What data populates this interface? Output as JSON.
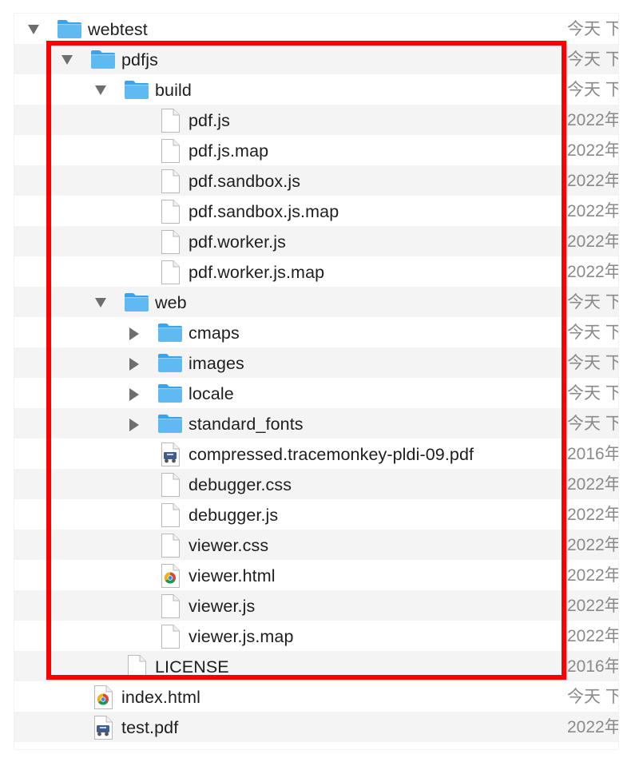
{
  "colors": {
    "highlight_border": "#ff0000",
    "folder_fill": "#5fbaf2",
    "folder_tab": "#3aa3ec",
    "row_alt": "#f4f4f5",
    "text": "#1e1e1e",
    "date_text": "#8a8a8a"
  },
  "items": [
    {
      "name": "webtest",
      "date": "今天 下",
      "kind": "folder",
      "depth": 0,
      "disclosure": "expanded",
      "icon": "folder-icon"
    },
    {
      "name": "pdfjs",
      "date": "今天 下",
      "kind": "folder",
      "depth": 1,
      "disclosure": "expanded",
      "icon": "folder-icon"
    },
    {
      "name": "build",
      "date": "今天 下",
      "kind": "folder",
      "depth": 2,
      "disclosure": "expanded",
      "icon": "folder-icon"
    },
    {
      "name": "pdf.js",
      "date": "2022年",
      "kind": "file",
      "depth": 3,
      "disclosure": "none",
      "icon": "document-icon"
    },
    {
      "name": "pdf.js.map",
      "date": "2022年",
      "kind": "file",
      "depth": 3,
      "disclosure": "none",
      "icon": "document-icon"
    },
    {
      "name": "pdf.sandbox.js",
      "date": "2022年",
      "kind": "file",
      "depth": 3,
      "disclosure": "none",
      "icon": "document-icon"
    },
    {
      "name": "pdf.sandbox.js.map",
      "date": "2022年",
      "kind": "file",
      "depth": 3,
      "disclosure": "none",
      "icon": "document-icon"
    },
    {
      "name": "pdf.worker.js",
      "date": "2022年",
      "kind": "file",
      "depth": 3,
      "disclosure": "none",
      "icon": "document-icon"
    },
    {
      "name": "pdf.worker.js.map",
      "date": "2022年",
      "kind": "file",
      "depth": 3,
      "disclosure": "none",
      "icon": "document-icon"
    },
    {
      "name": "web",
      "date": "今天 下",
      "kind": "folder",
      "depth": 2,
      "disclosure": "expanded",
      "icon": "folder-icon"
    },
    {
      "name": "cmaps",
      "date": "今天 下",
      "kind": "folder",
      "depth": 3,
      "disclosure": "collapsed",
      "icon": "folder-icon"
    },
    {
      "name": "images",
      "date": "今天 下",
      "kind": "folder",
      "depth": 3,
      "disclosure": "collapsed",
      "icon": "folder-icon"
    },
    {
      "name": "locale",
      "date": "今天 下",
      "kind": "folder",
      "depth": 3,
      "disclosure": "collapsed",
      "icon": "folder-icon"
    },
    {
      "name": "standard_fonts",
      "date": "今天 下",
      "kind": "folder",
      "depth": 3,
      "disclosure": "collapsed",
      "icon": "folder-icon"
    },
    {
      "name": "compressed.tracemonkey-pldi-09.pdf",
      "date": "2016年",
      "kind": "pdf",
      "depth": 3,
      "disclosure": "none",
      "icon": "pdf-preview-icon"
    },
    {
      "name": "debugger.css",
      "date": "2022年",
      "kind": "file",
      "depth": 3,
      "disclosure": "none",
      "icon": "document-icon"
    },
    {
      "name": "debugger.js",
      "date": "2022年",
      "kind": "file",
      "depth": 3,
      "disclosure": "none",
      "icon": "document-icon"
    },
    {
      "name": "viewer.css",
      "date": "2022年",
      "kind": "file",
      "depth": 3,
      "disclosure": "none",
      "icon": "document-icon"
    },
    {
      "name": "viewer.html",
      "date": "2022年",
      "kind": "html",
      "depth": 3,
      "disclosure": "none",
      "icon": "chrome-html-icon"
    },
    {
      "name": "viewer.js",
      "date": "2022年",
      "kind": "file",
      "depth": 3,
      "disclosure": "none",
      "icon": "document-icon"
    },
    {
      "name": "viewer.js.map",
      "date": "2022年",
      "kind": "file",
      "depth": 3,
      "disclosure": "none",
      "icon": "document-icon"
    },
    {
      "name": "LICENSE",
      "date": "2016年",
      "kind": "file",
      "depth": 2,
      "disclosure": "none",
      "icon": "document-icon"
    },
    {
      "name": "index.html",
      "date": "今天 下",
      "kind": "html",
      "depth": 1,
      "disclosure": "none",
      "icon": "chrome-html-icon"
    },
    {
      "name": "test.pdf",
      "date": "2022年",
      "kind": "pdf",
      "depth": 1,
      "disclosure": "none",
      "icon": "pdf-preview-icon"
    }
  ]
}
